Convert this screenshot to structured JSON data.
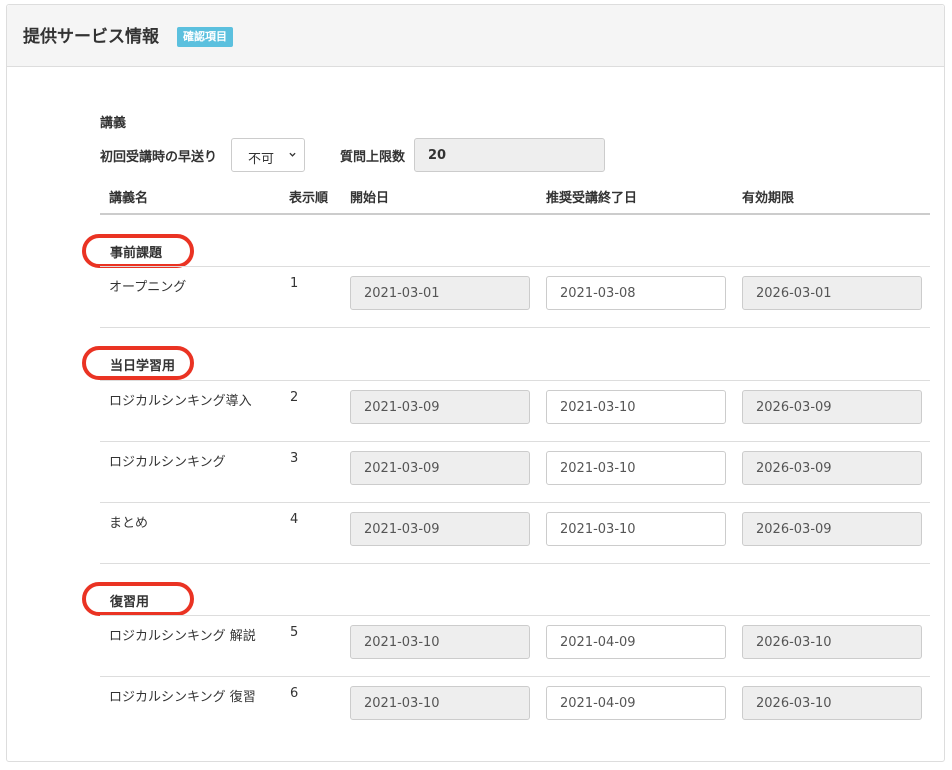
{
  "panel": {
    "title": "提供サービス情報",
    "badge": "確認項目"
  },
  "lecture_heading": "講義",
  "first_fast_forward": {
    "label": "初回受講時の早送り",
    "value": "不可"
  },
  "question_limit": {
    "label": "質問上限数",
    "value": "20"
  },
  "columns": {
    "name": "講義名",
    "order": "表示順",
    "start": "開始日",
    "recommended_end": "推奨受講終了日",
    "expiry": "有効期限"
  },
  "sections": [
    {
      "label": "事前課題",
      "rows": [
        {
          "name": "オープニング",
          "order": "1",
          "start": "2021-03-01",
          "recommended_end": "2021-03-08",
          "expiry": "2026-03-01"
        }
      ]
    },
    {
      "label": "当日学習用",
      "rows": [
        {
          "name": "ロジカルシンキング導入",
          "order": "2",
          "start": "2021-03-09",
          "recommended_end": "2021-03-10",
          "expiry": "2026-03-09"
        },
        {
          "name": "ロジカルシンキング",
          "order": "3",
          "start": "2021-03-09",
          "recommended_end": "2021-03-10",
          "expiry": "2026-03-09"
        },
        {
          "name": "まとめ",
          "order": "4",
          "start": "2021-03-09",
          "recommended_end": "2021-03-10",
          "expiry": "2026-03-09"
        }
      ]
    },
    {
      "label": "復習用",
      "rows": [
        {
          "name": "ロジカルシンキング 解説",
          "order": "5",
          "start": "2021-03-10",
          "recommended_end": "2021-04-09",
          "expiry": "2026-03-10"
        },
        {
          "name": "ロジカルシンキング 復習",
          "order": "6",
          "start": "2021-03-10",
          "recommended_end": "2021-04-09",
          "expiry": "2026-03-10"
        }
      ]
    }
  ],
  "colors": {
    "highlight": "#ea3323",
    "badge": "#5bc0de"
  }
}
